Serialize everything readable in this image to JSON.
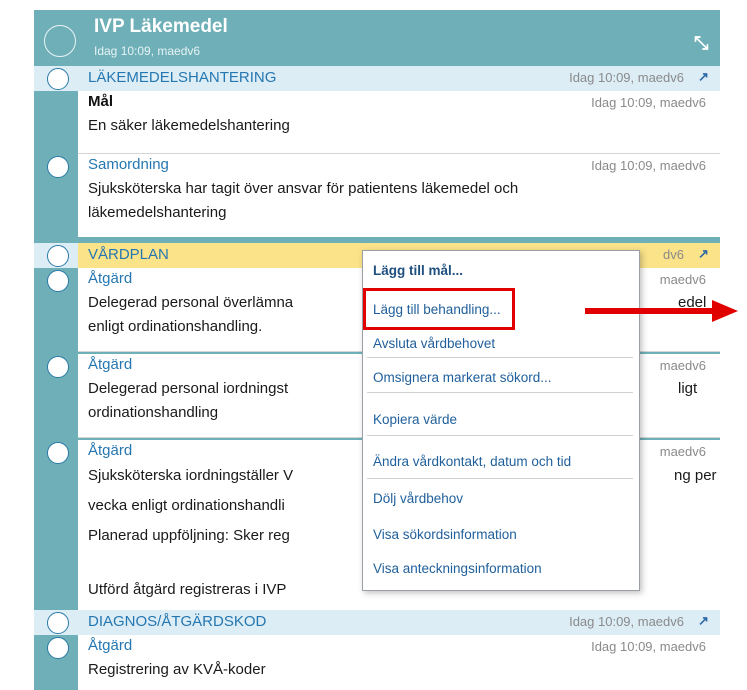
{
  "header": {
    "title": "IVP Läkemedel",
    "subtitle": "Idag 10:09, maedv6"
  },
  "categories": {
    "lakemedel": {
      "label": "LÄKEMEDELSHANTERING",
      "meta": "Idag 10:09, maedv6"
    },
    "vardplan": {
      "label": "VÅRDPLAN",
      "meta": "dv6"
    },
    "diagnos": {
      "label": "DIAGNOS/ÅTGÄRDSKOD",
      "meta": "Idag 10:09, maedv6"
    }
  },
  "entries": [
    {
      "title": "Mål",
      "meta": "Idag 10:09, maedv6",
      "lines": [
        "En säker läkemedelshantering"
      ]
    },
    {
      "title": "Samordning",
      "meta": "Idag 10:09, maedv6",
      "lines": [
        "Sjuksköterska har tagit över ansvar för patientens läkemedel och",
        "läkemedelshantering"
      ]
    },
    {
      "title": "Åtgärd",
      "meta": "maedv6",
      "lines": [
        "Delegerad personal överlämna",
        "enligt ordinationshandling."
      ],
      "tail": "edel"
    },
    {
      "title": "Åtgärd",
      "meta": "maedv6",
      "lines": [
        "Delegerad personal iordningst",
        "ordinationshandling"
      ],
      "tail": "ligt"
    },
    {
      "title": "Åtgärd",
      "meta": "maedv6",
      "lines": [
        "Sjuksköterska iordningställer V",
        "vecka enligt ordinationshandli",
        "Planerad uppföljning: Sker reg",
        "",
        "Utförd åtgärd registreras i IVP"
      ],
      "tail": "ng per"
    },
    {
      "title": "Åtgärd",
      "meta": "Idag 10:09, maedv6",
      "lines": [
        "Registrering av KVÅ-koder"
      ]
    }
  ],
  "context_menu": [
    "Lägg till mål...",
    "Lägg till behandling...",
    "Avsluta vårdbehovet",
    "Omsignera markerat sökord...",
    "Kopiera värde",
    "Ändra vårdkontakt, datum och tid",
    "Dölj vårdbehov",
    "Visa sökordsinformation",
    "Visa anteckningsinformation"
  ],
  "icons": {
    "pin": "pin-icon",
    "collapse": "collapse-icon"
  },
  "colors": {
    "header_bg": "#6fb0b8",
    "category_bg": "#dcedf6",
    "selected_bg": "#fbe38a",
    "highlight": "#e00000"
  }
}
